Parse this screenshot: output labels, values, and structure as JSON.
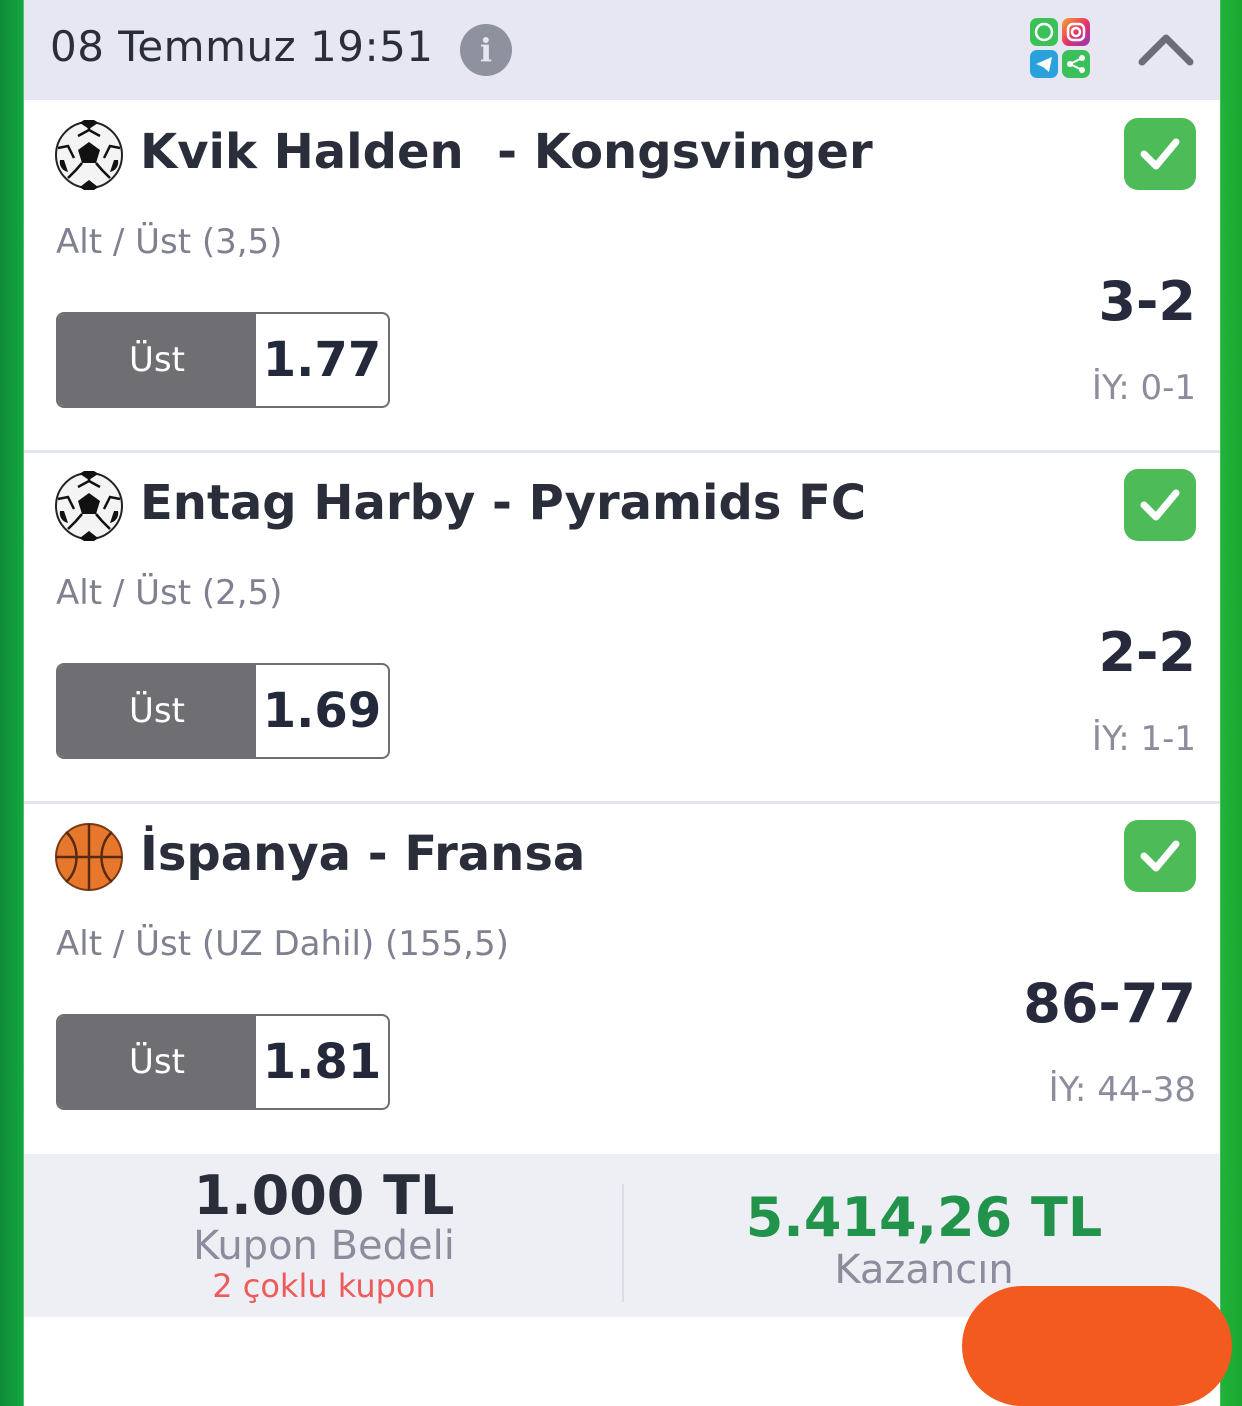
{
  "header": {
    "title": "08 Temmuz 19:51",
    "info_icon": "info-icon",
    "social_icons": [
      "whatsapp-icon",
      "instagram-icon",
      "telegram-icon",
      "share-icon"
    ],
    "collapse_icon": "chevron-up-icon"
  },
  "matches": [
    {
      "sport": "football",
      "title": "Kvik Halden  - Kongsvinger",
      "market": "Alt / Üst (3,5)",
      "pick": "Üst",
      "odds": "1.77",
      "score": "3-2",
      "half_time": "İY: 0-1",
      "status": "won"
    },
    {
      "sport": "football",
      "title": "Entag Harby - Pyramids FC",
      "market": "Alt / Üst (2,5)",
      "pick": "Üst",
      "odds": "1.69",
      "score": "2-2",
      "half_time": "İY: 1-1",
      "status": "won"
    },
    {
      "sport": "basketball",
      "title": "İspanya - Fransa",
      "market": "Alt / Üst (UZ Dahil) (155,5)",
      "pick": "Üst",
      "odds": "1.81",
      "score": "86-77",
      "half_time": "İY: 44-38",
      "status": "won"
    }
  ],
  "footer": {
    "stake_amount": "1.000 TL",
    "stake_label": "Kupon Bedeli",
    "stake_sub": "2 çoklu kupon",
    "win_amount": "5.414,26 TL",
    "win_label": "Kazancın"
  },
  "colors": {
    "accent_green": "#21934a",
    "check_green": "#4cbb58",
    "pick_grey": "#6f6f73",
    "header_bg": "#e6e7f2"
  }
}
